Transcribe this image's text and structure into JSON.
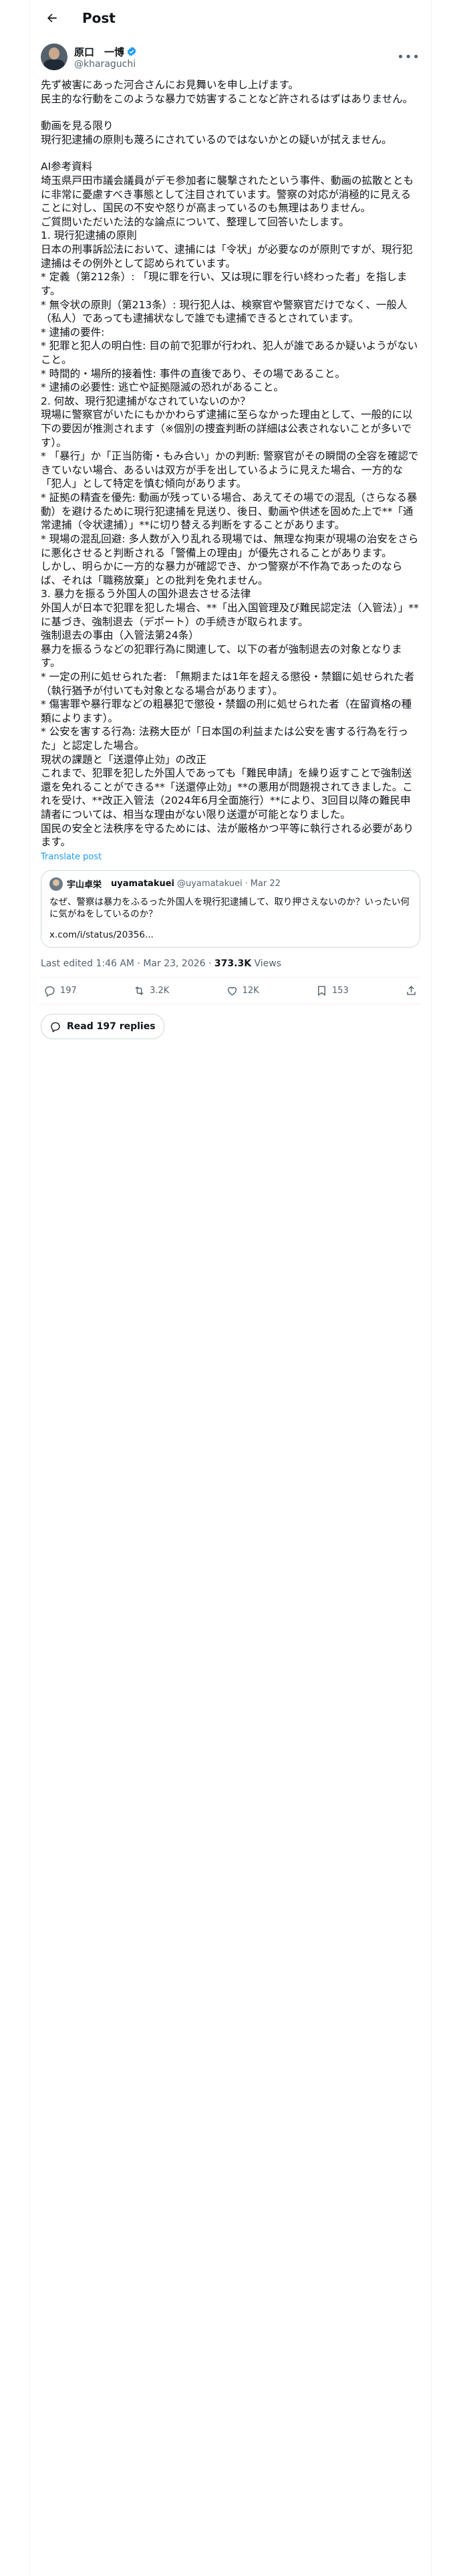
{
  "header": {
    "title": "Post"
  },
  "author": {
    "name": "原口　一博",
    "handle": "@kharaguchi"
  },
  "post_lines": [
    "先ず被害にあった河合さんにお見舞いを申し上げます。",
    "民主的な行動をこのような暴力で妨害することなど許されるはずはありません。",
    "",
    "動画を見る限り",
    "現行犯逮捕の原則も蔑ろにされているのではないかとの疑いが拭えません。",
    "",
    "AI参考資料",
    "埼玉県戸田市議会議員がデモ参加者に襲撃されたという事件、動画の拡散とともに非常に憂慮すべき事態として注目されています。警察の対応が消極的に見えることに対し、国民の不安や怒りが高まっているのも無理はありません。",
    "ご質問いただいた法的な論点について、整理して回答いたします。",
    "1. 現行犯逮捕の原則",
    "日本の刑事訴訟法において、逮捕には「令状」が必要なのが原則ですが、現行犯逮捕はその例外として認められています。",
    "* 定義（第212条）: 「現に罪を行い、又は現に罪を行い終わった者」を指します。",
    "* 無令状の原則（第213条）: 現行犯人は、検察官や警察官だけでなく、一般人（私人）であっても逮捕状なしで誰でも逮捕できるとされています。",
    "* 逮捕の要件:",
    "  * 犯罪と犯人の明白性: 目の前で犯罪が行われ、犯人が誰であるか疑いようがないこと。",
    "  * 時間的・場所的接着性: 事件の直後であり、その場であること。",
    "  * 逮捕の必要性: 逃亡や証拠隠滅の恐れがあること。",
    "2. 何故、現行犯逮捕がなされていないのか？",
    "現場に警察官がいたにもかかわらず逮捕に至らなかった理由として、一般的に以下の要因が推測されます（※個別の捜査判断の詳細は公表されないことが多いです）。",
    "* 「暴行」か「正当防衛・もみ合い」かの判断: 警察官がその瞬間の全容を確認できていない場合、あるいは双方が手を出しているように見えた場合、一方的な「犯人」として特定を慎む傾向があります。",
    "* 証拠の精査を優先: 動画が残っている場合、あえてその場での混乱（さらなる暴動）を避けるために現行犯逮捕を見送り、後日、動画や供述を固めた上で**「通常逮捕（令状逮捕）」**に切り替える判断をすることがあります。",
    "* 現場の混乱回避: 多人数が入り乱れる現場では、無理な拘束が現場の治安をさらに悪化させると判断される「警備上の理由」が優先されることがあります。",
    "しかし、明らかに一方的な暴力が確認でき、かつ警察が不作為であったのならば、それは「職務放棄」との批判を免れません。",
    "3. 暴力を振るう外国人の国外退去させる法律",
    "外国人が日本で犯罪を犯した場合、**「出入国管理及び難民認定法（入管法）」**に基づき、強制退去（デポート）の手続きが取られます。",
    "強制退去の事由（入管法第24条）",
    "暴力を振るうなどの犯罪行為に関連して、以下の者が強制退去の対象となります。",
    "* 一定の刑に処せられた者: 「無期または1年を超える懲役・禁錮に処せられた者（執行猶予が付いても対象となる場合があります）。",
    "  * 傷害罪や暴行罪などの粗暴犯で懲役・禁錮の刑に処せられた者（在留資格の種類によります）。",
    "* 公安を害する行為: 法務大臣が「日本国の利益または公安を害する行為を行った」と認定した場合。",
    "現状の課題と「送還停止効」の改正",
    "これまで、犯罪を犯した外国人であっても「難民申請」を繰り返すことで強制送還を免れることができる**「送還停止効」**の悪用が問題視されてきました。これを受け、**改正入管法（2024年6月全面施行）**により、3回目以降の難民申請者については、相当な理由がない限り送還が可能となりました。",
    "国民の安全と法秩序を守るためには、法が厳格かつ平等に執行される必要があります。"
  ],
  "translate_label": "Translate post",
  "quoted": {
    "name": "宇山卓栄",
    "handle": "uyamatakuei",
    "handle_at": "@uyamatakuei",
    "date": "Mar 22",
    "text": "なぜ、警察は暴力をふるった外国人を現行犯逮捕して、取り押さえないのか？いったい何に気がねをしているのか？",
    "link": "x.com/i/status/20356..."
  },
  "meta": {
    "edited": "Last edited 1:46 AM · Mar 23, 2026 · ",
    "views_count": "373.3K",
    "views_label": " Views"
  },
  "actions": {
    "replies": "197",
    "reposts": "3.2K",
    "likes": "12K",
    "bookmarks": "153"
  },
  "read_replies": "Read 197 replies",
  "colors": {
    "accent": "#1d9bf0",
    "muted": "#536471",
    "border": "#cfd9de"
  }
}
